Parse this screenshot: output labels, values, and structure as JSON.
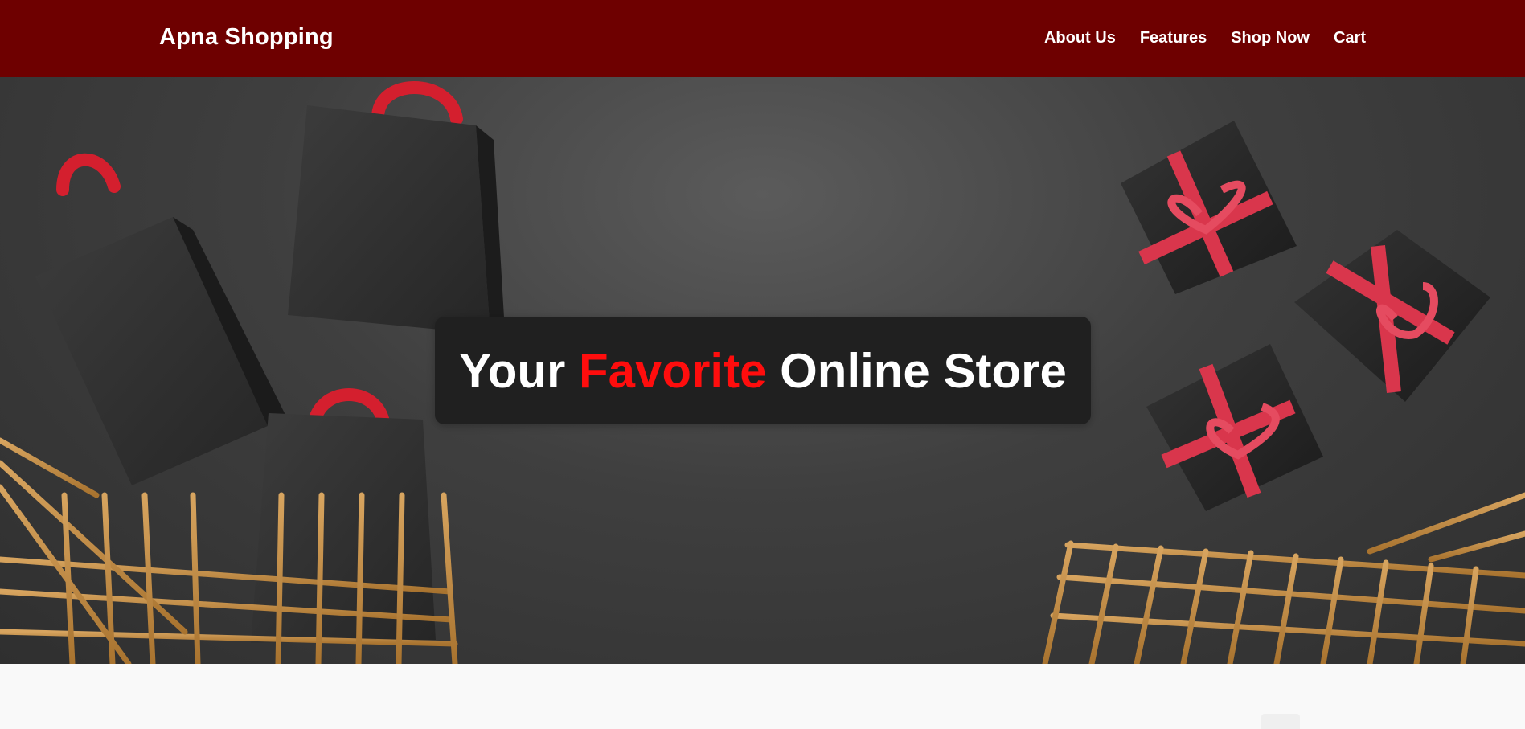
{
  "navbar": {
    "brand": "Apna Shopping",
    "links": [
      "About Us",
      "Features",
      "Shop Now",
      "Cart"
    ],
    "background": "#6e0000"
  },
  "hero": {
    "headline_before": "Your",
    "headline_accent": "Favorite",
    "headline_after": "Online Store",
    "accent_color": "#ff0d0d",
    "image_subject": "shopping bags, gift boxes and golden carts on dark background"
  }
}
